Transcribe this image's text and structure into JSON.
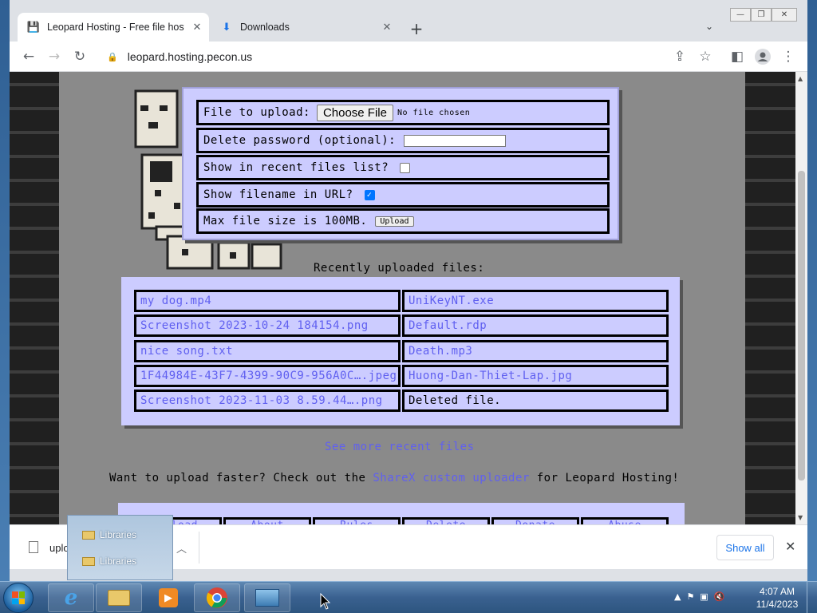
{
  "browser": {
    "tabs": [
      {
        "title": "Leopard Hosting - Free file hosting",
        "active": true
      },
      {
        "title": "Downloads",
        "active": false
      }
    ],
    "url": "leopard.hosting.pecon.us"
  },
  "upload_form": {
    "file_label": "File to upload:",
    "choose_file": "Choose File",
    "no_file": "No file chosen",
    "password_label": "Delete password (optional):",
    "password_value": "",
    "recent_label": "Show in recent files list?",
    "recent_checked": false,
    "filename_label": "Show filename in URL?",
    "filename_checked": true,
    "max_size": "Max file size is 100MB.",
    "upload_button": "Upload"
  },
  "recent": {
    "title": "Recently uploaded files:",
    "left": [
      "my dog.mp4",
      "Screenshot 2023-10-24 184154.png",
      "nice song.txt",
      "1F44984E-43F7-4399-90C9-956A0C….jpeg",
      "Screenshot 2023-11-03 8.59.44….png"
    ],
    "right": [
      "UniKeyNT.exe",
      "Default.rdp",
      "Death.mp3",
      "Huong-Dan-Thiet-Lap.jpg",
      "Deleted file."
    ],
    "see_more": "See more recent files",
    "faster_prefix": "Want to upload faster? Check out the",
    "faster_link": "ShareX custom uploader",
    "faster_suffix": "for Leopard Hosting!"
  },
  "bottom_nav": [
    "Upload",
    "About",
    "Rules",
    "Delete",
    "Donate",
    "Abuse"
  ],
  "download_shelf": {
    "filename": "uplo",
    "show_all": "Show all"
  },
  "jump_list": [
    "Libraries",
    "Libraries"
  ],
  "clock": {
    "time": "4:07 AM",
    "date": "11/4/2023"
  },
  "colors": {
    "link": "#6060f0",
    "panel": "#ccccff"
  }
}
